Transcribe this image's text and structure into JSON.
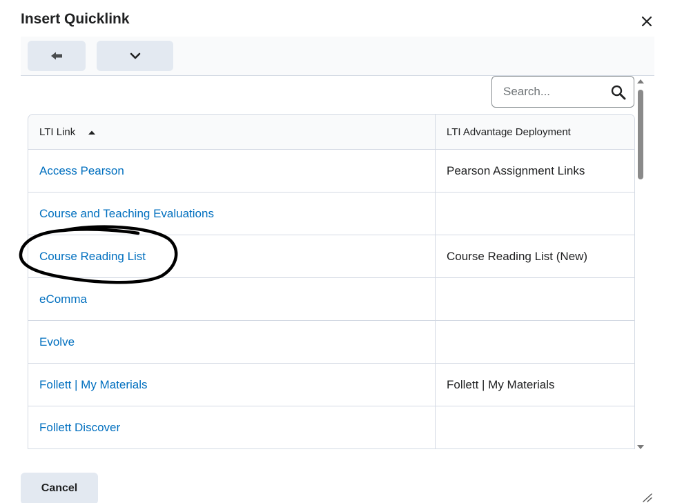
{
  "dialog": {
    "title": "Insert Quicklink",
    "close_icon": "close-icon"
  },
  "toolbar": {
    "back_icon": "back-arrow-icon",
    "more_icon": "chevron-down-icon"
  },
  "search": {
    "placeholder": "Search...",
    "icon": "search-icon"
  },
  "table": {
    "headers": [
      "LTI Link",
      "LTI Advantage Deployment"
    ],
    "sort": "ascending",
    "rows": [
      {
        "link": "Access Pearson",
        "deployment": "Pearson Assignment Links"
      },
      {
        "link": "Course and Teaching Evaluations",
        "deployment": ""
      },
      {
        "link": "Course Reading List",
        "deployment": "Course Reading List (New)"
      },
      {
        "link": "eComma",
        "deployment": ""
      },
      {
        "link": "Evolve",
        "deployment": ""
      },
      {
        "link": "Follett | My Materials",
        "deployment": "Follett | My Materials"
      },
      {
        "link": "Follett Discover",
        "deployment": ""
      }
    ]
  },
  "footer": {
    "cancel_label": "Cancel"
  },
  "colors": {
    "link": "#006fbf",
    "button_bg": "#e3e9f1",
    "border": "#d3d9e3",
    "annotation": "#000000"
  }
}
